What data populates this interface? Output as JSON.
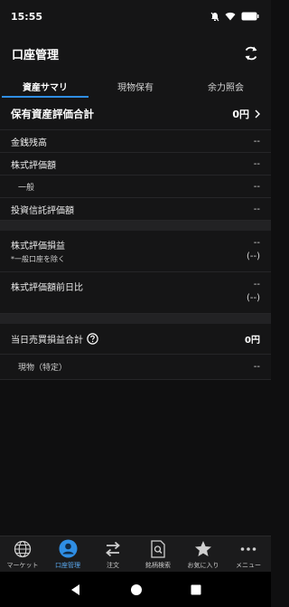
{
  "status_bar": {
    "time": "15:55"
  },
  "header": {
    "title": "口座管理"
  },
  "tabs": [
    {
      "label": "資産サマリ",
      "active": true
    },
    {
      "label": "現物保有",
      "active": false
    },
    {
      "label": "余力照会",
      "active": false
    }
  ],
  "summary": {
    "total_label": "保有資産評価合計",
    "total_value": "0円",
    "cash_label": "金銭残高",
    "cash_value": "--",
    "stock_label": "株式評価額",
    "stock_value": "--",
    "general_label": "一般",
    "general_value": "--",
    "fund_label": "投資信託評価額",
    "fund_value": "--"
  },
  "pl": {
    "stock_pl_label": "株式評価損益",
    "stock_pl_note": "*一般口座を除く",
    "stock_pl_value": "--",
    "stock_pl_value2": "(--)",
    "stock_prev_label": "株式評価額前日比",
    "stock_prev_value": "--",
    "stock_prev_value2": "(--)"
  },
  "daily": {
    "label": "当日売買損益合計",
    "value": "0円",
    "sub_label": "現物（特定）",
    "sub_value": "--"
  },
  "bottom_nav": [
    {
      "label": "マーケット",
      "icon": "globe-icon",
      "active": false
    },
    {
      "label": "口座管理",
      "icon": "account-icon",
      "active": true
    },
    {
      "label": "注文",
      "icon": "swap-icon",
      "active": false
    },
    {
      "label": "銘柄検索",
      "icon": "search-doc-icon",
      "active": false
    },
    {
      "label": "お気に入り",
      "icon": "star-icon",
      "active": false
    },
    {
      "label": "メニュー",
      "icon": "more-icon",
      "active": false
    }
  ],
  "colors": {
    "accent": "#2f8ee4",
    "background": "#0f0f10",
    "panel": "#151516"
  }
}
